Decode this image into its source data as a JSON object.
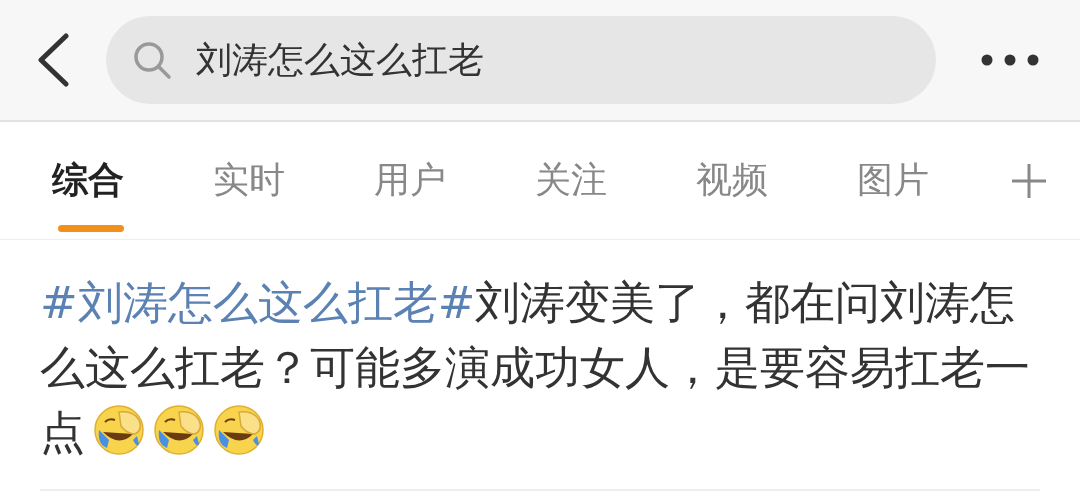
{
  "search": {
    "value": "刘涛怎么这么扛老"
  },
  "tabs": [
    {
      "label": "综合",
      "selected": true
    },
    {
      "label": "实时",
      "selected": false
    },
    {
      "label": "用户",
      "selected": false
    },
    {
      "label": "关注",
      "selected": false
    },
    {
      "label": "视频",
      "selected": false
    },
    {
      "label": "图片",
      "selected": false
    }
  ],
  "post": {
    "hashtag": "#刘涛怎么这么扛老#",
    "text": "刘涛变美了，都在问刘涛怎么这么扛老？可能多演成功女人，是要容易扛老一点",
    "emojis": [
      {
        "kind": "laugh-cry-facepalm"
      },
      {
        "kind": "laugh-cry-facepalm"
      },
      {
        "kind": "laugh-cry-facepalm"
      }
    ]
  }
}
